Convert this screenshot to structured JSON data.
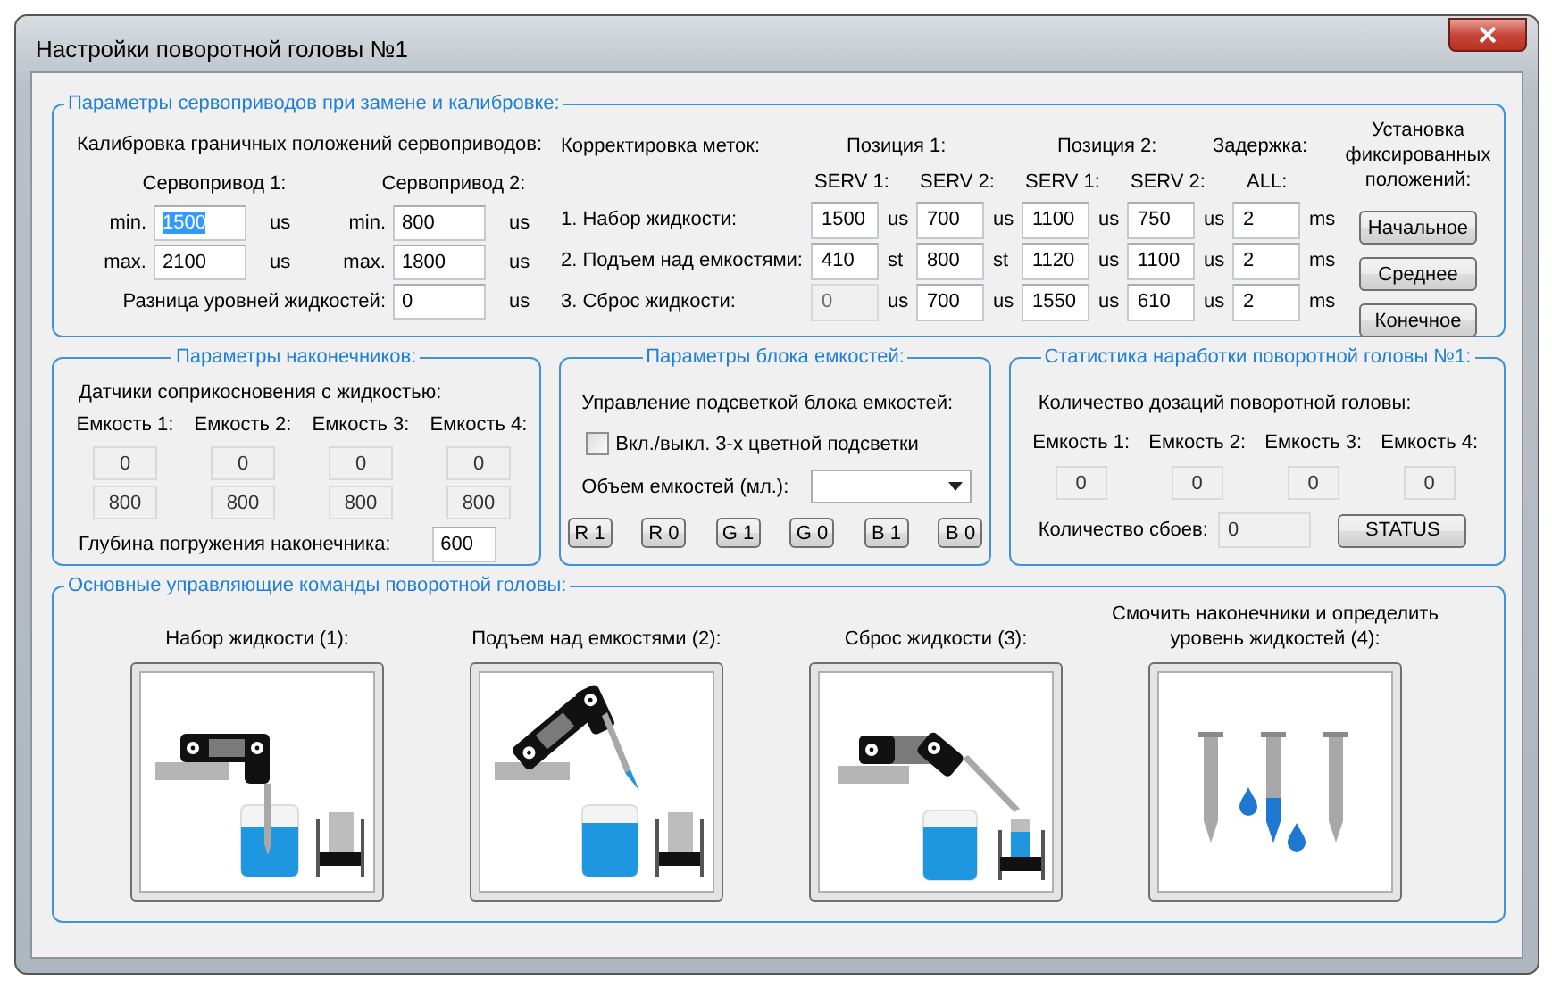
{
  "window": {
    "title": "Настройки поворотной головы №1"
  },
  "servo_group": {
    "title": "Параметры сервоприводов при замене и калибровке:",
    "calibration": {
      "heading": "Калибровка граничных положений сервоприводов:",
      "servos": [
        {
          "label": "Сервопривод 1:",
          "fields": [
            {
              "label": "min.",
              "value": "1500",
              "unit": "us",
              "highlighted": true
            },
            {
              "label": "max.",
              "value": "2100",
              "unit": "us",
              "highlighted": false
            }
          ]
        },
        {
          "label": "Сервопривод 2:",
          "fields": [
            {
              "label": "min.",
              "value": "800",
              "unit": "us",
              "highlighted": false
            },
            {
              "label": "max.",
              "value": "1800",
              "unit": "us",
              "highlighted": false
            }
          ]
        }
      ],
      "diff": {
        "label": "Разница уровней жидкостей:",
        "value": "0",
        "unit": "us"
      }
    },
    "marks": {
      "heading": "Корректировка меток:",
      "position_headers": [
        "Позиция 1:",
        "Позиция 2:"
      ],
      "delay_header": "Задержка:",
      "column_headers": [
        "SERV 1:",
        "SERV 2:",
        "SERV 1:",
        "SERV 2:",
        "ALL:"
      ],
      "rows": [
        {
          "label": "1. Набор жидкости:",
          "cells": [
            {
              "value": "1500",
              "unit": "us",
              "disabled": false
            },
            {
              "value": "700",
              "unit": "us",
              "disabled": false
            },
            {
              "value": "1100",
              "unit": "us",
              "disabled": false
            },
            {
              "value": "750",
              "unit": "us",
              "disabled": false
            },
            {
              "value": "2",
              "unit": "ms",
              "disabled": false
            }
          ]
        },
        {
          "label": "2. Подъем над емкостями:",
          "cells": [
            {
              "value": "410",
              "unit": "st",
              "disabled": false
            },
            {
              "value": "800",
              "unit": "st",
              "disabled": false
            },
            {
              "value": "1120",
              "unit": "us",
              "disabled": false
            },
            {
              "value": "1100",
              "unit": "us",
              "disabled": false
            },
            {
              "value": "2",
              "unit": "ms",
              "disabled": false
            }
          ]
        },
        {
          "label": "3. Сброс жидкости:",
          "cells": [
            {
              "value": "0",
              "unit": "us",
              "disabled": true
            },
            {
              "value": "700",
              "unit": "us",
              "disabled": false
            },
            {
              "value": "1550",
              "unit": "us",
              "disabled": false
            },
            {
              "value": "610",
              "unit": "us",
              "disabled": false
            },
            {
              "value": "2",
              "unit": "ms",
              "disabled": false
            }
          ]
        }
      ]
    },
    "fixed": {
      "heading": "Установка фиксированных положений:",
      "buttons": [
        "Начальное",
        "Среднее",
        "Конечное"
      ]
    }
  },
  "tips_group": {
    "title": "Параметры наконечников:",
    "heading": "Датчики соприкосновения с жидкостью:",
    "containers": [
      {
        "label": "Емкость 1:",
        "values": [
          "0",
          "800"
        ]
      },
      {
        "label": "Емкость 2:",
        "values": [
          "0",
          "800"
        ]
      },
      {
        "label": "Емкость 3:",
        "values": [
          "0",
          "800"
        ]
      },
      {
        "label": "Емкость 4:",
        "values": [
          "0",
          "800"
        ]
      }
    ],
    "depth": {
      "label": "Глубина погружения наконечника:",
      "value": "600"
    }
  },
  "block_group": {
    "title": "Параметры блока емкостей:",
    "heading": "Управление подсветкой блока емкостей:",
    "checkbox": {
      "label": "Вкл./выкл. 3-х цветной подсветки",
      "checked": false
    },
    "volume": {
      "label": "Объем емкостей (мл.):"
    },
    "buttons": [
      "R 1",
      "R 0",
      "G 1",
      "G 0",
      "B 1",
      "B 0"
    ]
  },
  "stats_group": {
    "title": "Статистика наработки поворотной головы №1:",
    "heading": "Количество дозаций поворотной головы:",
    "containers": [
      {
        "label": "Емкость 1:",
        "value": "0"
      },
      {
        "label": "Емкость 2:",
        "value": "0"
      },
      {
        "label": "Емкость 3:",
        "value": "0"
      },
      {
        "label": "Емкость 4:",
        "value": "0"
      }
    ],
    "failures": {
      "label": "Количество сбоев:",
      "value": "0"
    },
    "button": "STATUS"
  },
  "commands_group": {
    "title": "Основные управляющие команды поворотной головы:",
    "commands": [
      {
        "label": "Набор жидкости (1):",
        "kind": "draw"
      },
      {
        "label": "Подъем над емкостями (2):",
        "kind": "lift"
      },
      {
        "label": "Сброс жидкости (3):",
        "kind": "dispense"
      },
      {
        "label": "Смочить наконечники и определить уровень жидкостей (4):",
        "kind": "wet"
      }
    ]
  }
}
